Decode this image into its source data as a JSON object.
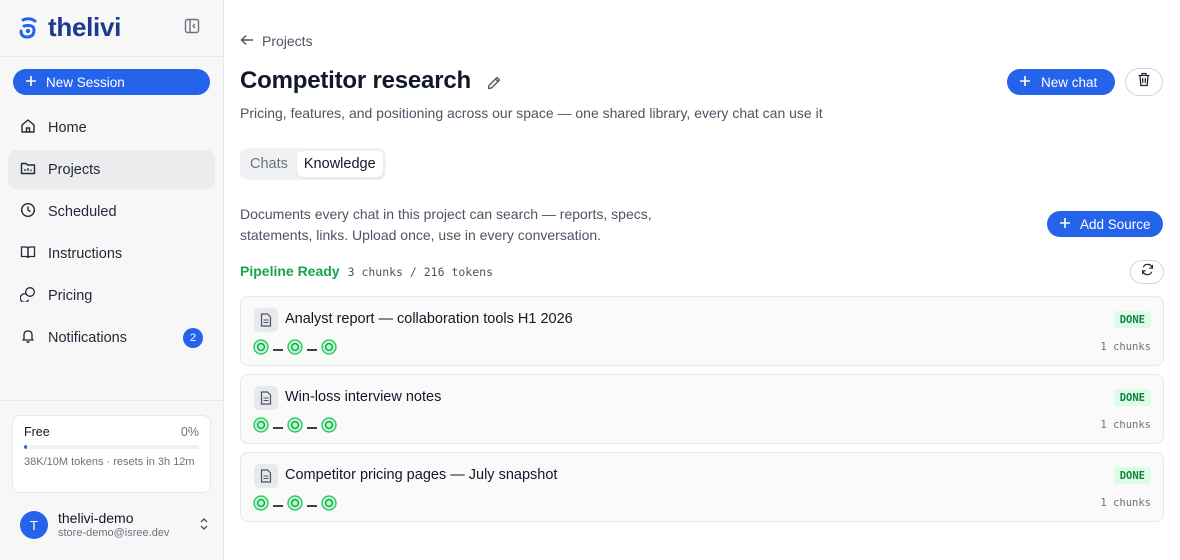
{
  "brand": {
    "name": "thelivi"
  },
  "sidebar": {
    "new_session_label": "New Session",
    "items": [
      {
        "label": "Home",
        "icon": "home-icon"
      },
      {
        "label": "Projects",
        "icon": "folder-icon",
        "active": true
      },
      {
        "label": "Scheduled",
        "icon": "clock-icon"
      },
      {
        "label": "Instructions",
        "icon": "book-icon"
      },
      {
        "label": "Pricing",
        "icon": "coins-icon"
      },
      {
        "label": "Notifications",
        "icon": "bell-icon",
        "badge": "2"
      }
    ],
    "plan": {
      "name": "Free",
      "percent_label": "0%",
      "usage_fraction": 0.0038,
      "usage_text": "38K/10M tokens · resets in 3h 12m"
    },
    "user": {
      "initial": "T",
      "name": "thelivi-demo",
      "email": "store-demo@isree.dev"
    }
  },
  "header": {
    "back_label": "Projects",
    "title": "Competitor research",
    "subtitle": "Pricing, features, and positioning across our space — one shared library, every chat can use it",
    "new_chat_label": "New chat"
  },
  "tabs": [
    {
      "label": "Chats",
      "active": false
    },
    {
      "label": "Knowledge",
      "active": true
    }
  ],
  "knowledge": {
    "description": "Documents every chat in this project can search — reports, specs, statements, links. Upload once, use in every conversation.",
    "add_source_label": "Add Source",
    "pipeline_status": "Pipeline Ready",
    "pipeline_meta": "3 chunks / 216 tokens",
    "documents": [
      {
        "name": "Analyst report — collaboration tools H1 2026",
        "status": "DONE",
        "chunks": "1 chunks"
      },
      {
        "name": "Win-loss interview notes",
        "status": "DONE",
        "chunks": "1 chunks"
      },
      {
        "name": "Competitor pricing pages — July snapshot",
        "status": "DONE",
        "chunks": "1 chunks"
      }
    ]
  },
  "colors": {
    "accent": "#2563eb",
    "success": "#16a34a",
    "brand_text": "#1e3a8a"
  }
}
